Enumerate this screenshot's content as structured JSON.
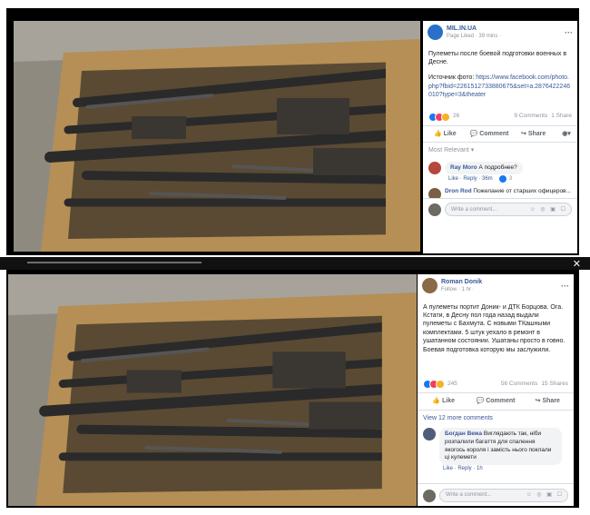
{
  "post1": {
    "page_name": "MIL.IN.UA",
    "meta": "Page Liked · 39 mins ·",
    "text": "Пулеметы после боевой подготовки военных в Десне.",
    "source_label": "Источник фото:",
    "source_link": "https://www.facebook.com/photo.php?fbid=2261512733880675&set=a.2876422246010?type=3&theater",
    "reaction_count": "26",
    "comments_count": "9 Comments",
    "shares_count": "1 Share",
    "like_label": "Like",
    "comment_label": "Comment",
    "share_label": "Share",
    "sort_label": "Most Relevant",
    "comments": [
      {
        "author": "Ray Moro",
        "text": "А подробнее?",
        "actions": "Like · Reply · 36m",
        "reactions": "3"
      },
      {
        "author": "Dron Rod",
        "text": "Пожелание от старших офицеров..."
      }
    ],
    "write_placeholder": "Write a comment..."
  },
  "post2": {
    "author": "Roman Donik",
    "meta": "Follow · 1 hr ·",
    "text": "А пулеметы портит Доник- и ДТК Борцова. Ога. Кстати, в Десну пол года назад выдали пулеметы с Бахмута. С новыми ТКашными комплектами. 5 штук уехало в ремонт в ушатанном состоянии. Ушатаны просто в говно. Боевая подготовка которую мы заслужили.",
    "reaction_count": "245",
    "comments_count": "56 Comments",
    "shares_count": "15 Shares",
    "like_label": "Like",
    "comment_label": "Comment",
    "share_label": "Share",
    "more_comments": "View 12 more comments",
    "comment": {
      "author": "Богдан Вежа",
      "text": "Виглядають так, ніби розпалили багаття для спалення якогось короля і замість нього поклали ці кулемети",
      "actions": "Like · Reply · 1h"
    },
    "write_placeholder": "Write a comment..."
  },
  "colors": {
    "fb_blue": "#385898",
    "like_blue": "#1877f2",
    "love_red": "#f33e58",
    "haha_yellow": "#f7b125"
  }
}
